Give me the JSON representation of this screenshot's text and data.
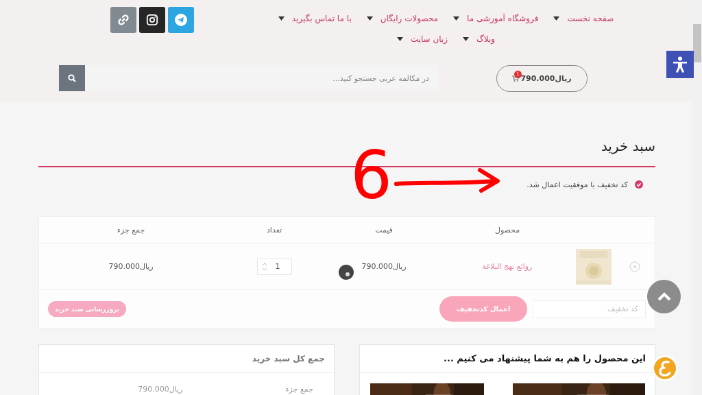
{
  "social_links": [
    {
      "kind": "telegram"
    },
    {
      "kind": "instagram"
    },
    {
      "kind": "link"
    }
  ],
  "nav": [
    {
      "label": "صفحه نخست"
    },
    {
      "label": "فروشگاه آموزشی ما"
    },
    {
      "label": "محصولات رایگان"
    },
    {
      "label": "با ما تماس بگیرید"
    },
    {
      "label": "وبلاگ"
    },
    {
      "label": "زبان سایت"
    }
  ],
  "search": {
    "placeholder": "در مکالمه عربی جستجو کنید..."
  },
  "cart": {
    "total": "ریال790.000",
    "count": "1"
  },
  "page_title": "سبد خرید",
  "notice": "کد تخفیف با موفقیت اعمال شد.",
  "annotation": {
    "text": "6"
  },
  "cart_table": {
    "columns": [
      "محصول",
      "قیمت",
      "تعداد",
      "جمع جزء"
    ],
    "rows": [
      {
        "product": "روائع نهج البلاغة",
        "price": "ریال790.000",
        "quantity": "1",
        "subtotal": "ریال790.000"
      }
    ]
  },
  "coupon": {
    "placeholder": "کد تخفیف"
  },
  "apply_button": "اعمال کدتخفیف",
  "update_button": {
    "label": "بروزرسانی سبد خرید",
    "disabled": true
  },
  "recommend": {
    "title": "این محصول را هم به شما پیشنهاد می کنیم ..."
  },
  "totals": {
    "title": "جمع کل سبد خرید",
    "rows": [
      {
        "label": "جمع جزء",
        "value": "ریال790.000"
      }
    ]
  }
}
